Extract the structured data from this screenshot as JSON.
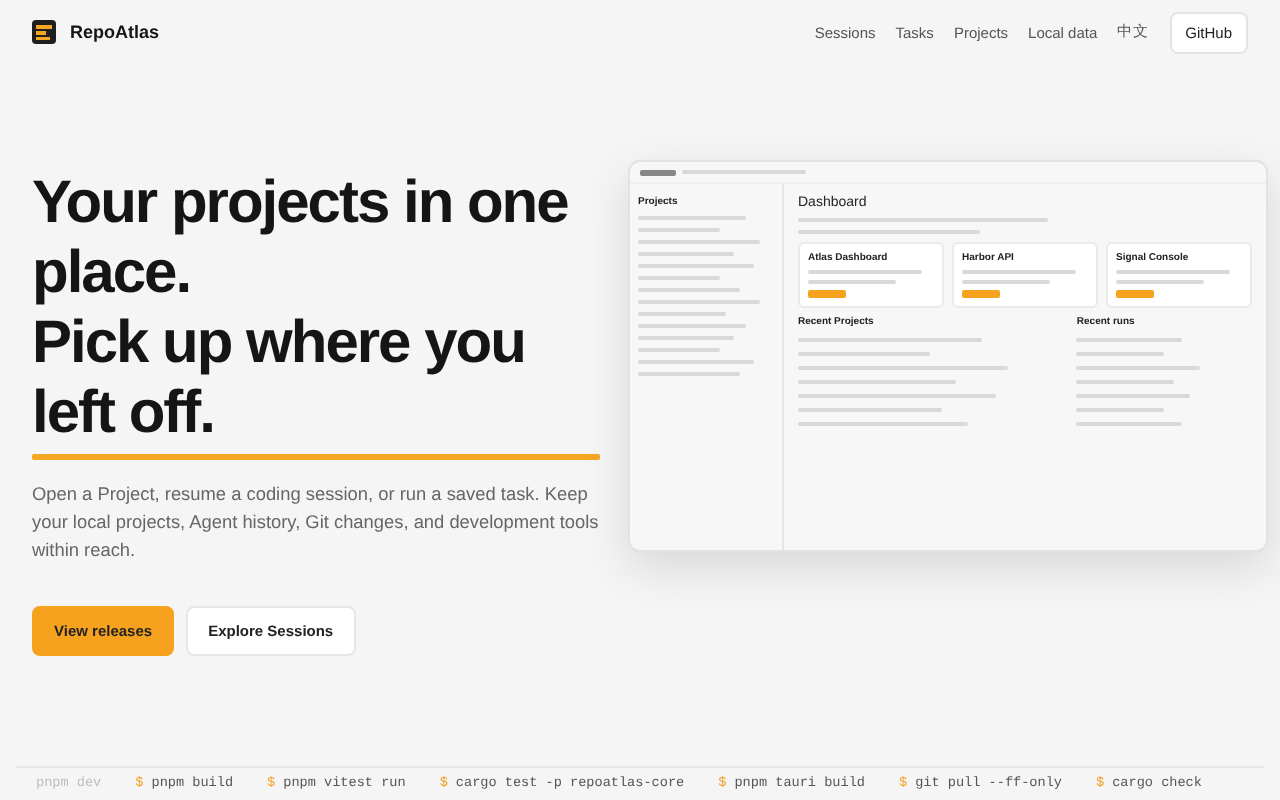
{
  "nav": {
    "brand": "RepoAtlas",
    "links": [
      "Sessions",
      "Tasks",
      "Projects",
      "Local data",
      "中文"
    ],
    "button": "GitHub"
  },
  "hero": {
    "title_lines": [
      "Your projects in one",
      "place.",
      "Pick up where you",
      "left off."
    ],
    "text": "Open a Project, resume a coding session, or run a saved task. Keep your local projects, Agent history, Git changes, and development tools within reach.",
    "buttons": [
      {
        "label": "View releases",
        "kind": "primary"
      },
      {
        "label": "Explore Sessions",
        "kind": "secondary"
      }
    ]
  },
  "app_preview": {
    "sidebar_title": "Projects",
    "heading": "Dashboard",
    "cards": [
      {
        "name": "Atlas Dashboard"
      },
      {
        "name": "Harbor API"
      },
      {
        "name": "Signal Console"
      }
    ],
    "recent_projects_title": "Recent Projects",
    "recent_runs_title": "Recent runs"
  },
  "commands": [
    {
      "text": "pnpm dev",
      "faded": true
    },
    {
      "prompt": "$",
      "text": "pnpm build",
      "faded": false
    },
    {
      "prompt": "$",
      "text": "pnpm vitest run",
      "faded": false
    },
    {
      "prompt": "$",
      "text": "cargo test -p repoatlas-core",
      "faded": false
    },
    {
      "prompt": "$",
      "text": "pnpm tauri build",
      "faded": false
    },
    {
      "prompt": "$",
      "text": "git pull --ff-only",
      "faded": false
    },
    {
      "prompt": "$",
      "text": "cargo check",
      "faded": false
    }
  ]
}
